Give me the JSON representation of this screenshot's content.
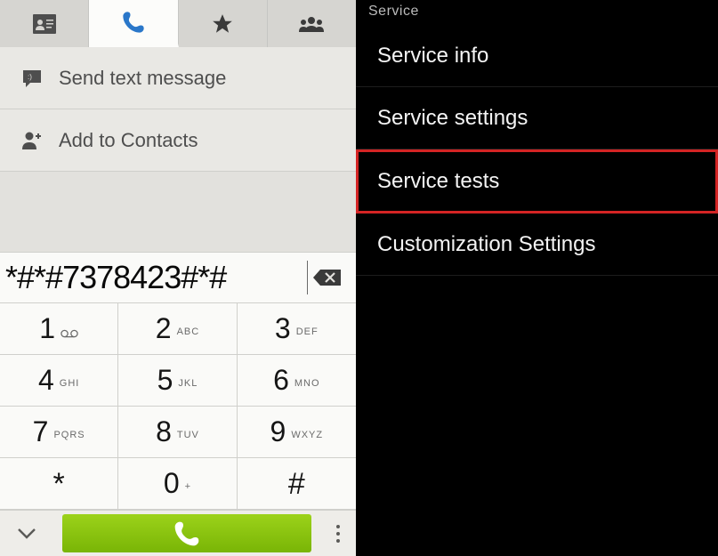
{
  "dialer": {
    "actions": {
      "send_text": "Send text message",
      "add_contact": "Add to Contacts"
    },
    "display": "*#*#7378423#*#",
    "keys": [
      {
        "digit": "1",
        "letters": ""
      },
      {
        "digit": "2",
        "letters": "ABC"
      },
      {
        "digit": "3",
        "letters": "DEF"
      },
      {
        "digit": "4",
        "letters": "GHI"
      },
      {
        "digit": "5",
        "letters": "JKL"
      },
      {
        "digit": "6",
        "letters": "MNO"
      },
      {
        "digit": "7",
        "letters": "PQRS"
      },
      {
        "digit": "8",
        "letters": "TUV"
      },
      {
        "digit": "9",
        "letters": "WXYZ"
      },
      {
        "digit": "*",
        "letters": ""
      },
      {
        "digit": "0",
        "letters": "+"
      },
      {
        "digit": "#",
        "letters": ""
      }
    ]
  },
  "service": {
    "title": "Service",
    "items": [
      {
        "label": "Service info",
        "highlighted": false
      },
      {
        "label": "Service settings",
        "highlighted": false
      },
      {
        "label": "Service tests",
        "highlighted": true
      },
      {
        "label": "Customization Settings",
        "highlighted": false
      }
    ]
  }
}
